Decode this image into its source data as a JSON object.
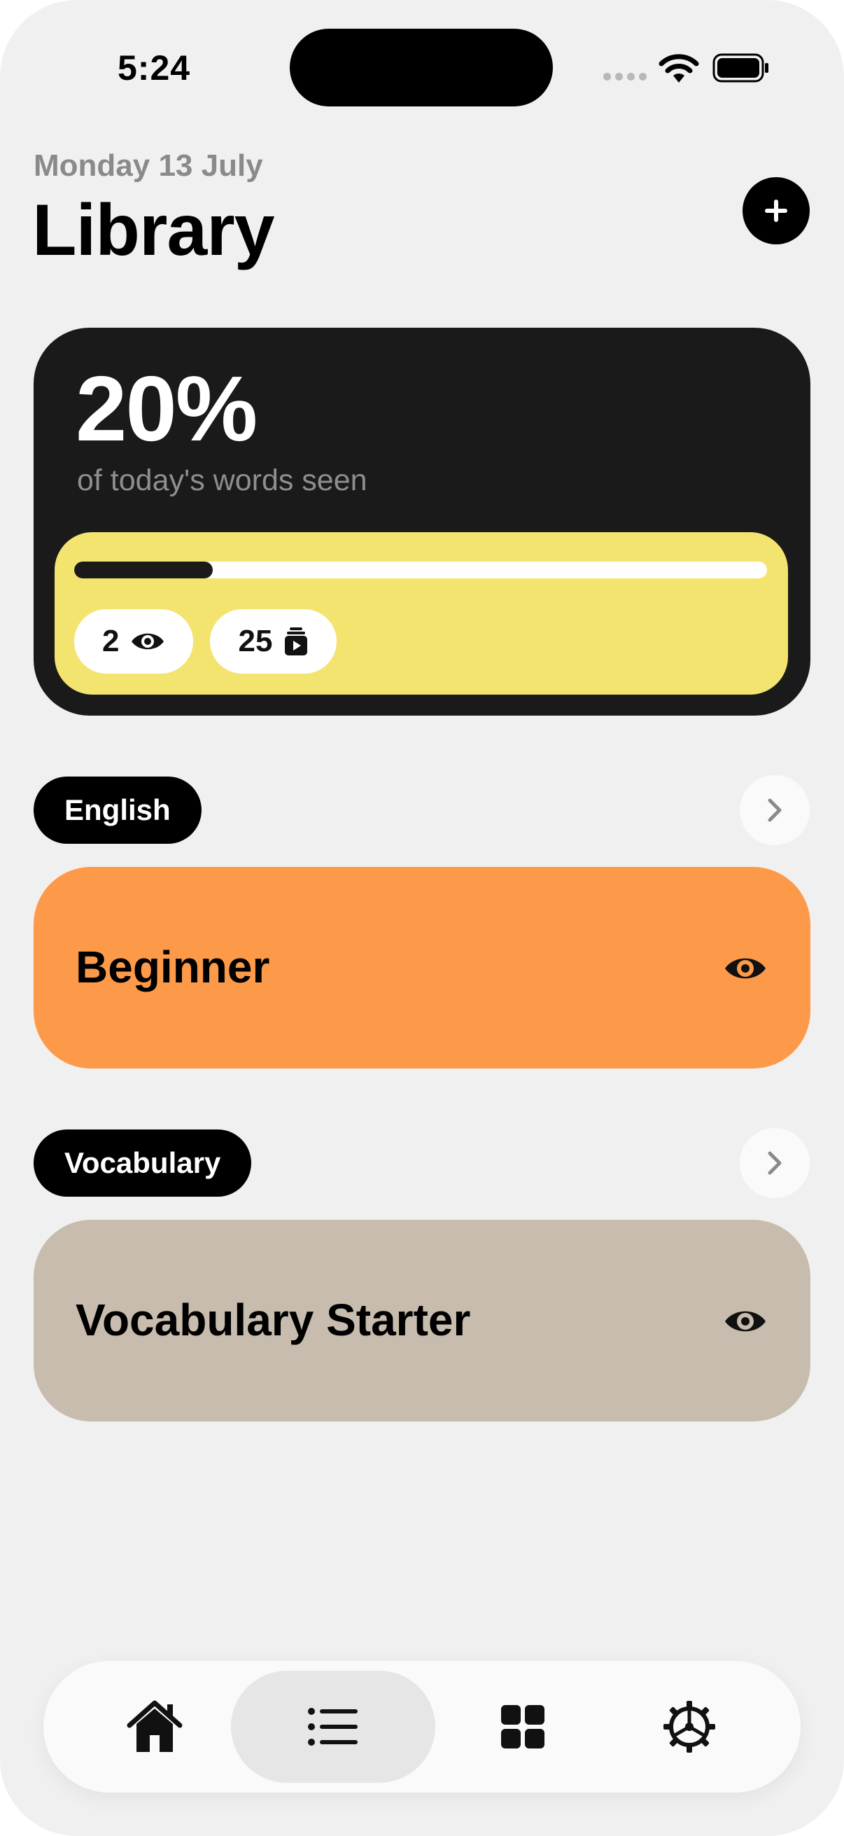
{
  "status_bar": {
    "time": "5:24"
  },
  "header": {
    "date": "Monday 13 July",
    "title": "Library",
    "add_icon": "plus-icon"
  },
  "stats": {
    "percent_label": "20%",
    "subtitle": "of today's words seen",
    "progress": 0.2,
    "seen_count": "2",
    "seen_icon": "eye-icon",
    "cards_count": "25",
    "cards_icon": "card-stack-icon"
  },
  "sections": [
    {
      "tag": "English",
      "deck_title": "Beginner",
      "color": "#fd9a4a"
    },
    {
      "tag": "Vocabulary",
      "deck_title": "Vocabulary Starter",
      "color": "#c7bcad"
    }
  ],
  "tabbar": {
    "tabs": [
      {
        "icon": "home-icon",
        "active": false
      },
      {
        "icon": "list-icon",
        "active": true
      },
      {
        "icon": "grid-icon",
        "active": false
      },
      {
        "icon": "settings-gear-icon",
        "active": false
      }
    ]
  },
  "colors": {
    "accent_yellow": "#f3e46f",
    "card_dark": "#1a1a1a",
    "background": "#f0f0f0"
  }
}
